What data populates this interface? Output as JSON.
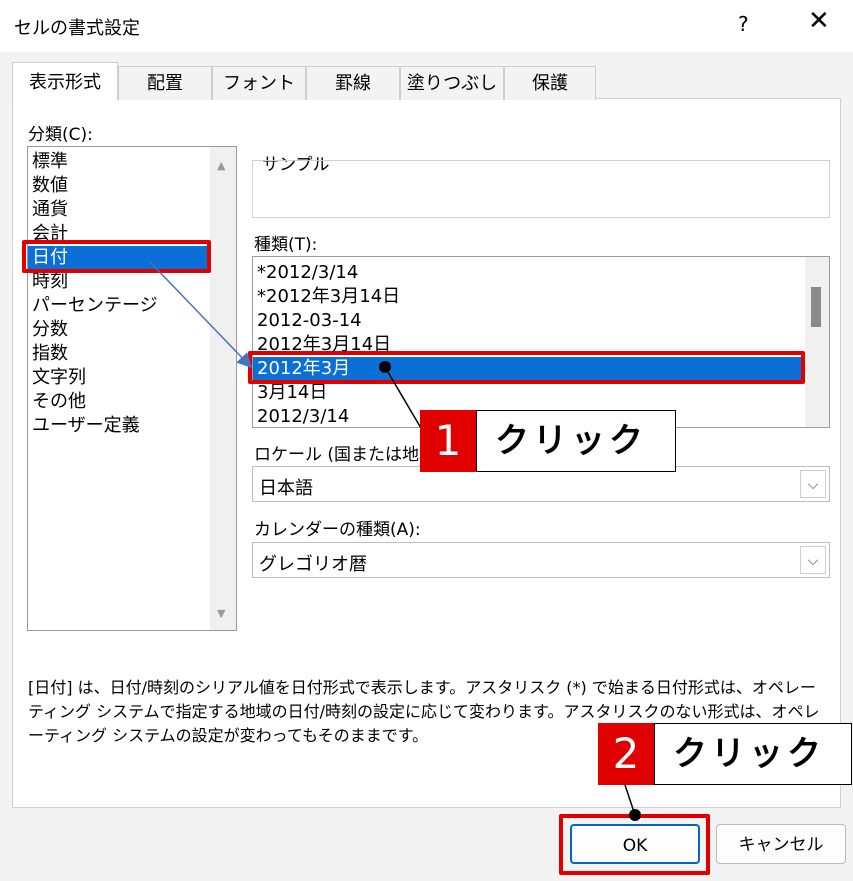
{
  "window": {
    "title": "セルの書式設定",
    "help": "?",
    "close": "✕"
  },
  "tabs": [
    {
      "label": "表示形式",
      "active": true
    },
    {
      "label": "配置"
    },
    {
      "label": "フォント"
    },
    {
      "label": "罫線"
    },
    {
      "label": "塗りつぶし"
    },
    {
      "label": "保護"
    }
  ],
  "category": {
    "label": "分類(C):",
    "items": [
      "標準",
      "数値",
      "通貨",
      "会計",
      "日付",
      "時刻",
      "パーセンテージ",
      "分数",
      "指数",
      "文字列",
      "その他",
      "ユーザー定義"
    ],
    "selected": "日付"
  },
  "sample": {
    "label": "サンプル",
    "value": ""
  },
  "type": {
    "label": "種類(T):",
    "items": [
      "*2012/3/14",
      "*2012年3月14日",
      "2012-03-14",
      "2012年3月14日",
      "2012年3月",
      "3月14日",
      "2012/3/14"
    ],
    "selected": "2012年3月"
  },
  "locale": {
    "label": "ロケール (国または地域)(L):",
    "value": "日本語"
  },
  "calendar": {
    "label": "カレンダーの種類(A):",
    "value": "グレゴリオ暦"
  },
  "description": "[日付] は、日付/時刻のシリアル値を日付形式で表示します。アスタリスク (*) で始まる日付形式は、オペレーティング システムで指定する地域の日付/時刻の設定に応じて変わります。アスタリスクのない形式は、オペレーティング システムの設定が変わってもそのままです。",
  "buttons": {
    "ok": "OK",
    "cancel": "キャンセル"
  },
  "callouts": [
    {
      "number": "1",
      "text": "クリック"
    },
    {
      "number": "2",
      "text": "クリック"
    }
  ],
  "colors": {
    "selection": "#0a6fd6",
    "highlight": "#e00000"
  }
}
